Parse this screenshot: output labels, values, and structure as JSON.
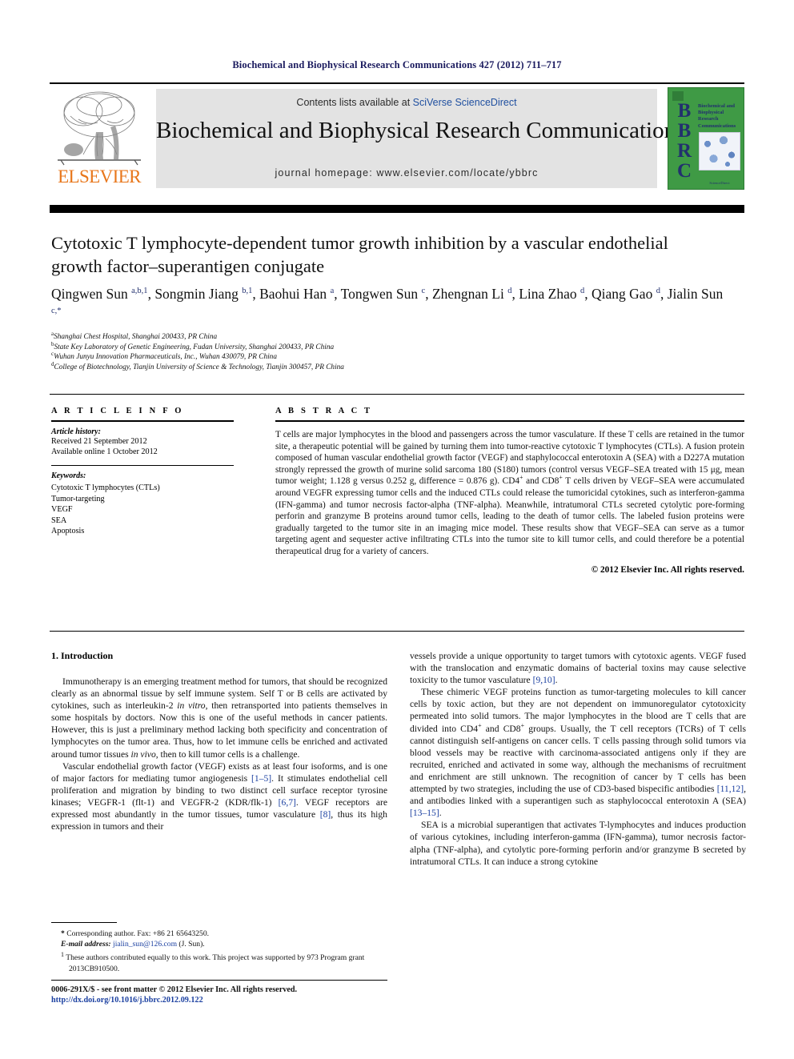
{
  "running_head": "Biochemical and Biophysical Research Communications 427 (2012) 711–717",
  "masthead": {
    "contents_prefix": "Contents lists available at ",
    "contents_link": "SciVerse ScienceDirect",
    "journal_title": "Biochemical and Biophysical Research Communications",
    "homepage": "journal homepage: www.elsevier.com/locate/ybbrc",
    "elsevier_wordmark": "ELSEVIER",
    "cover": {
      "letters": "BBRC",
      "journal_name": "Biochemical and Biophysical Research Communications",
      "footer": "ScienceDirect"
    },
    "colors": {
      "band_gray": "#e3e3e3",
      "elsevier_orange": "#E8761A",
      "cover_green": "#3f9a45",
      "cover_navy": "#22306e",
      "link_blue": "#2050a0"
    }
  },
  "article": {
    "title": "Cytotoxic T lymphocyte-dependent tumor growth inhibition by a vascular endothelial growth factor–superantigen conjugate",
    "authors_html": "Qingwen Sun <sup>a,b,1</sup>, Songmin Jiang <sup>b,1</sup>, Baohui Han <sup>a</sup>, Tongwen Sun <sup>c</sup>, Zhengnan Li <sup>d</sup>, Lina Zhao <sup>d</sup>, Qiang Gao <sup>d</sup>, Jialin Sun <sup>c,*</sup>",
    "affiliations": [
      {
        "marker": "a",
        "text": "Shanghai Chest Hospital, Shanghai 200433, PR China"
      },
      {
        "marker": "b",
        "text": "State Key Laboratory of Genetic Engineering, Fudan University, Shanghai 200433, PR China"
      },
      {
        "marker": "c",
        "text": "Wuhan Junyu Innovation Pharmaceuticals, Inc., Wuhan 430079, PR China"
      },
      {
        "marker": "d",
        "text": "College of Biotechnology, Tianjin University of Science & Technology, Tianjin 300457, PR China"
      }
    ]
  },
  "article_info": {
    "heading": "A R T I C L E    I N F O",
    "history_label": "Article history:",
    "history": [
      "Received 21 September 2012",
      "Available online 1 October 2012"
    ],
    "keywords_label": "Keywords:",
    "keywords": [
      "Cytotoxic T lymphocytes (CTLs)",
      "Tumor-targeting",
      "VEGF",
      "SEA",
      "Apoptosis"
    ]
  },
  "abstract": {
    "heading": "A B S T R A C T",
    "body_html": "T cells are major lymphocytes in the blood and passengers across the tumor vasculature. If these T cells are retained in the tumor site, a therapeutic potential will be gained by turning them into tumor-reactive cytotoxic T lymphocytes (CTLs). A fusion protein composed of human vascular endothelial growth factor (VEGF) and staphylococcal enterotoxin A (SEA) with a D227A mutation strongly repressed the growth of murine solid sarcoma 180 (S180) tumors (control versus VEGF–SEA treated with 15 μg, mean tumor weight; 1.128 g versus 0.252 g, difference = 0.876 g). CD4<sup>+</sup> and CD8<sup>+</sup> T cells driven by VEGF–SEA were accumulated around VEGFR expressing tumor cells and the induced CTLs could release the tumoricidal cytokines, such as interferon-gamma (IFN-gamma) and tumor necrosis factor-alpha (TNF-alpha). Meanwhile, intratumoral CTLs secreted cytolytic pore-forming perforin and granzyme B proteins around tumor cells, leading to the death of tumor cells. The labeled fusion proteins were gradually targeted to the tumor site in an imaging mice model. These results show that VEGF–SEA can serve as a tumor targeting agent and sequester active infiltrating CTLs into the tumor site to kill tumor cells, and could therefore be a potential therapeutical drug for a variety of cancers.",
    "copyright": "© 2012 Elsevier Inc. All rights reserved."
  },
  "body": {
    "section_title": "1. Introduction",
    "left_paragraphs_html": [
      "Immunotherapy is an emerging treatment method for tumors, that should be recognized clearly as an abnormal tissue by self immune system. Self T or B cells are activated by cytokines, such as interleukin-2 <i>in vitro</i>, then retransported into patients themselves in some hospitals by doctors. Now this is one of the useful methods in cancer patients. However, this is just a preliminary method lacking both specificity and concentration of lymphocytes on the tumor area. Thus, how to let immune cells be enriched and activated around tumor tissues <i>in vivo</i>, then to kill tumor cells is a challenge.",
      "Vascular endothelial growth factor (VEGF) exists as at least four isoforms, and is one of major factors for mediating tumor angiogenesis <span class=\"ref\">[1–5]</span>. It stimulates endothelial cell proliferation and migration by binding to two distinct cell surface receptor tyrosine kinases; VEGFR-1 (flt-1) and VEGFR-2 (KDR/flk-1) <span class=\"ref\">[6,7]</span>. VEGF receptors are expressed most abundantly in the tumor tissues, tumor vasculature <span class=\"ref\">[8]</span>, thus its high expression in tumors and their"
    ],
    "right_paragraphs_html": [
      "vessels provide a unique opportunity to target tumors with cytotoxic agents. VEGF fused with the translocation and enzymatic domains of bacterial toxins may cause selective toxicity to the tumor vasculature <span class=\"ref\">[9,10]</span>.",
      "These chimeric VEGF proteins function as tumor-targeting molecules to kill cancer cells by toxic action, but they are not dependent on immunoregulator cytotoxicity permeated into solid tumors. The major lymphocytes in the blood are T cells that are divided into CD4<sup>+</sup> and CD8<sup>+</sup> groups. Usually, the T cell receptors (TCRs) of T cells cannot distinguish self-antigens on cancer cells. T cells passing through solid tumors via blood vessels may be reactive with carcinoma-associated antigens only if they are recruited, enriched and activated in some way, although the mechanisms of recruitment and enrichment are still unknown. The recognition of cancer by T cells has been attempted by two strategies, including the use of CD3-based bispecific antibodies <span class=\"ref\">[11,12]</span>, and antibodies linked with a superantigen such as staphylococcal enterotoxin A (SEA) <span class=\"ref\">[13–15]</span>.",
      "SEA is a microbial superantigen that activates T-lymphocytes and induces production of various cytokines, including interferon-gamma (IFN-gamma), tumor necrosis factor-alpha (TNF-alpha), and cytolytic pore-forming perforin and/or granzyme B secreted by intratumoral CTLs. It can induce a strong cytokine"
    ],
    "right_first_paragraph_indent": false
  },
  "footnotes": {
    "corresponding_html": "<span class=\"star\">*</span> Corresponding author. Fax: +86 21 65643250.",
    "email_label": "E-mail address:",
    "email": "jialin_sun@126.com",
    "email_suffix": " (J. Sun).",
    "equal_contrib_html": "<sup>1</sup> These authors contributed equally to this work. This project was supported by 973 Program grant 2013CB910500."
  },
  "footer": {
    "issn_line": "0006-291X/$ - see front matter © 2012 Elsevier Inc. All rights reserved.",
    "doi": "http://dx.doi.org/10.1016/j.bbrc.2012.09.122"
  }
}
